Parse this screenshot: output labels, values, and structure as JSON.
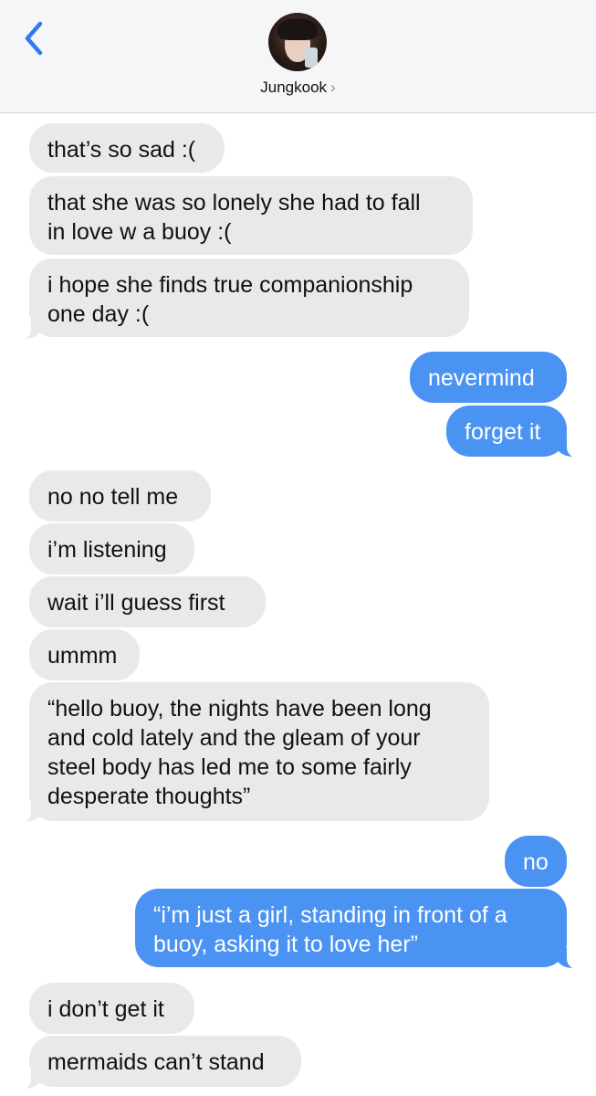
{
  "header": {
    "contact_name": "Jungkook",
    "chevron": "›",
    "back_icon": "chevron-left-icon",
    "accent_color": "#3478f6"
  },
  "messages": [
    {
      "from": "them",
      "text": "that’s so sad :("
    },
    {
      "from": "them",
      "text": "that she was so lonely she had to fall\nin love w a buoy :("
    },
    {
      "from": "them",
      "text": "i hope she finds true companionship\none day :("
    },
    {
      "from": "me",
      "text": "nevermind"
    },
    {
      "from": "me",
      "text": "forget it"
    },
    {
      "from": "them",
      "text": "no no tell me"
    },
    {
      "from": "them",
      "text": "i’m listening"
    },
    {
      "from": "them",
      "text": "wait i’ll guess first"
    },
    {
      "from": "them",
      "text": "ummm"
    },
    {
      "from": "them",
      "text": "“hello buoy, the nights have been long\nand cold lately and the gleam of your\nsteel body has led me to some fairly\ndesperate thoughts”"
    },
    {
      "from": "me",
      "text": "no"
    },
    {
      "from": "me",
      "text": "“i’m just a girl, standing in front of a\nbuoy, asking it to love her”"
    },
    {
      "from": "them",
      "text": "i don’t get it"
    },
    {
      "from": "them",
      "text": "mermaids can’t stand"
    }
  ],
  "colors": {
    "incoming_bubble": "#e9e9eb",
    "outgoing_bubble": "#4a93f3",
    "header_bg": "#f6f6f8"
  }
}
